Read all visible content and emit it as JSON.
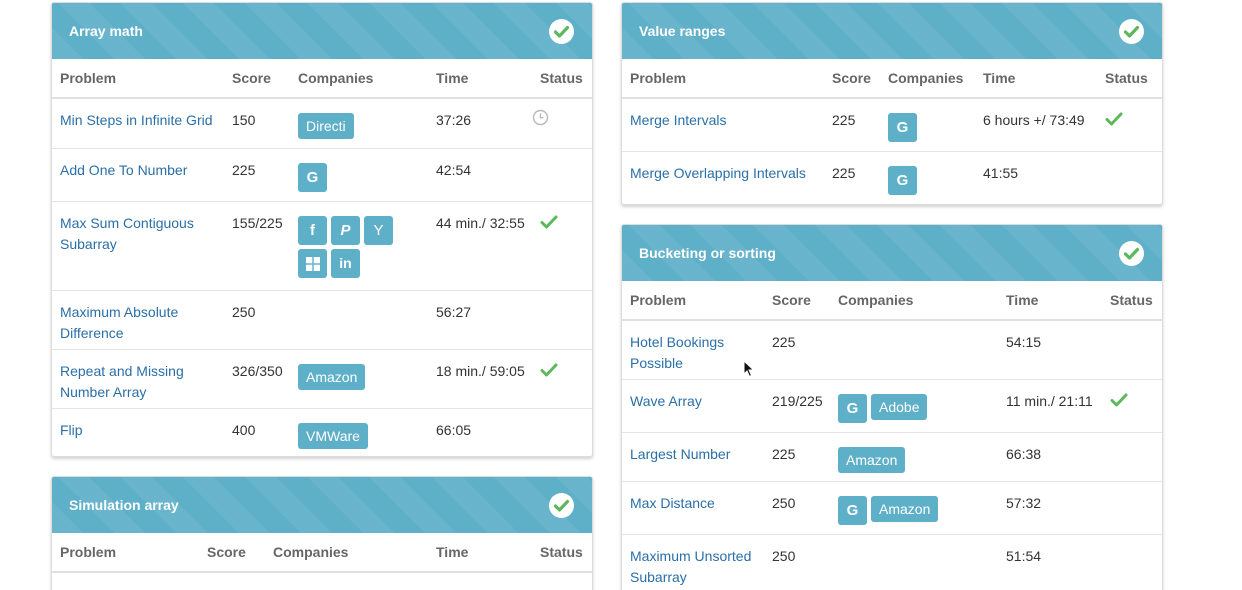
{
  "colors": {
    "header": "#5eafc8",
    "link": "#2a6fa8",
    "check": "#5cb85c",
    "badge": "#5eafc8"
  },
  "columns": {
    "problem": "Problem",
    "score": "Score",
    "companies": "Companies",
    "time": "Time",
    "status": "Status"
  },
  "panels": {
    "array_math": {
      "title": "Array math",
      "rows": [
        {
          "problem": "Min Steps in Infinite Grid",
          "score": "150",
          "companies": [
            "Directi"
          ],
          "time": "37:26",
          "status": "clock"
        },
        {
          "problem": "Add One To Number",
          "score": "225",
          "companies": [
            "google-icon"
          ],
          "time": "42:54",
          "status": ""
        },
        {
          "problem": "Max Sum Contiguous Subarray",
          "score": "155/225",
          "companies": [
            "facebook-icon",
            "paypal-icon",
            "ycombinator-icon",
            "windows-icon",
            "linkedin-icon"
          ],
          "time": "44 min./ 32:55",
          "status": "check"
        },
        {
          "problem": "Maximum Absolute Difference",
          "score": "250",
          "companies": [],
          "time": "56:27",
          "status": ""
        },
        {
          "problem": "Repeat and Missing Number Array",
          "score": "326/350",
          "companies": [
            "Amazon"
          ],
          "time": "18 min./ 59:05",
          "status": "check"
        },
        {
          "problem": "Flip",
          "score": "400",
          "companies": [
            "VMWare"
          ],
          "time": "66:05",
          "status": ""
        }
      ]
    },
    "simulation_array": {
      "title": "Simulation array"
    },
    "value_ranges": {
      "title": "Value ranges",
      "rows": [
        {
          "problem": "Merge Intervals",
          "score": "225",
          "companies": [
            "google-icon"
          ],
          "time": "6 hours +/ 73:49",
          "status": "check"
        },
        {
          "problem": "Merge Overlapping Intervals",
          "score": "225",
          "companies": [
            "google-icon"
          ],
          "time": "41:55",
          "status": ""
        }
      ]
    },
    "bucketing": {
      "title": "Bucketing or sorting",
      "rows": [
        {
          "problem": "Hotel Bookings Possible",
          "score": "225",
          "companies": [],
          "time": "54:15",
          "status": ""
        },
        {
          "problem": "Wave Array",
          "score": "219/225",
          "companies": [
            "google-icon",
            "Adobe"
          ],
          "time": "11 min./ 21:11",
          "status": "check"
        },
        {
          "problem": "Largest Number",
          "score": "225",
          "companies": [
            "Amazon"
          ],
          "time": "66:38",
          "status": ""
        },
        {
          "problem": "Max Distance",
          "score": "250",
          "companies": [
            "google-icon",
            "Amazon"
          ],
          "time": "57:32",
          "status": ""
        },
        {
          "problem": "Maximum Unsorted Subarray",
          "score": "250",
          "companies": [],
          "time": "51:54",
          "status": ""
        }
      ]
    }
  }
}
